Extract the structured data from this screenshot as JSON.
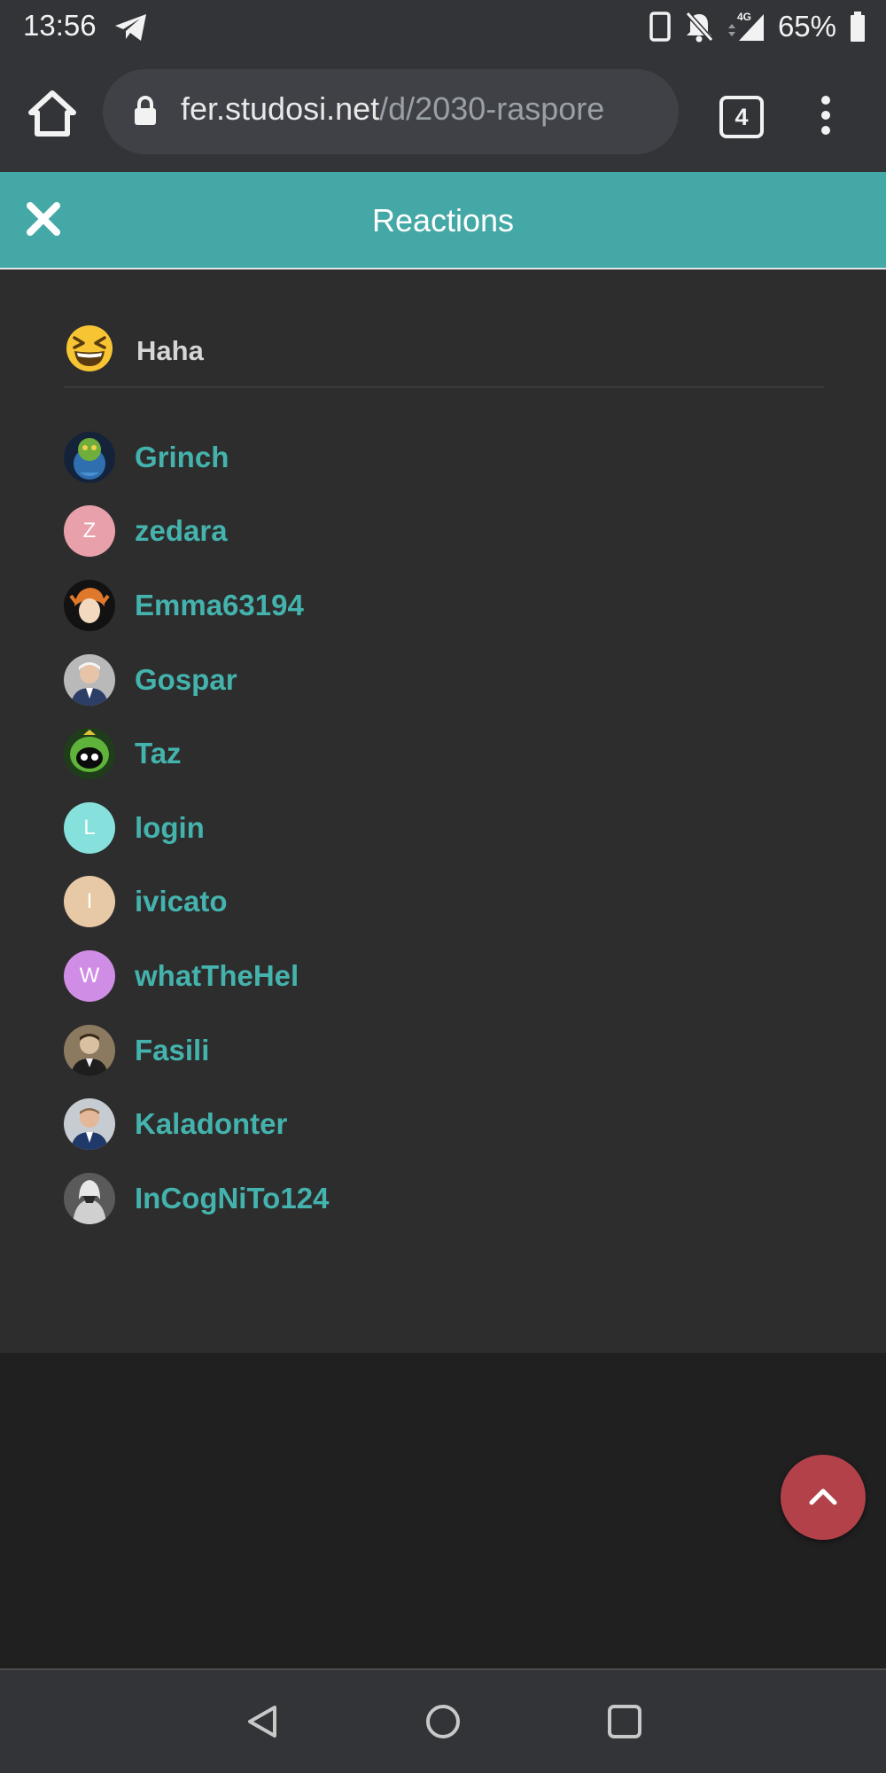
{
  "status_bar": {
    "time": "13:56",
    "network": "4G",
    "battery": "65%",
    "icons": [
      "telegram-icon",
      "phone-vibrate-icon",
      "notifications-off-icon",
      "signal-icon",
      "battery-icon"
    ]
  },
  "browser": {
    "url_domain": "fer.studosi.net",
    "url_path": "/d/2030-raspore",
    "tab_count": "4"
  },
  "modal": {
    "title": "Reactions",
    "reaction": {
      "label": "Haha",
      "icon": "laughing-emoji-icon"
    },
    "users": [
      {
        "name": "Grinch",
        "avatar": "image"
      },
      {
        "name": "zedara",
        "avatar": "letter",
        "letter": "Z",
        "color": "#e8a0aa"
      },
      {
        "name": "Emma63194",
        "avatar": "image"
      },
      {
        "name": "Gospar",
        "avatar": "image"
      },
      {
        "name": "Taz",
        "avatar": "image"
      },
      {
        "name": "login",
        "avatar": "letter",
        "letter": "L",
        "color": "#86e0db"
      },
      {
        "name": "ivicato",
        "avatar": "letter",
        "letter": "I",
        "color": "#e8c9a6"
      },
      {
        "name": "whatTheHel",
        "avatar": "letter",
        "letter": "W",
        "color": "#d08de6"
      },
      {
        "name": "Fasili",
        "avatar": "image"
      },
      {
        "name": "Kaladonter",
        "avatar": "image"
      },
      {
        "name": "InCogNiTo124",
        "avatar": "image"
      }
    ]
  },
  "colors": {
    "accent": "#44a9a6",
    "username": "#44b3ad",
    "scroll_button": "#b2414a",
    "background": "#2d2d2d"
  }
}
